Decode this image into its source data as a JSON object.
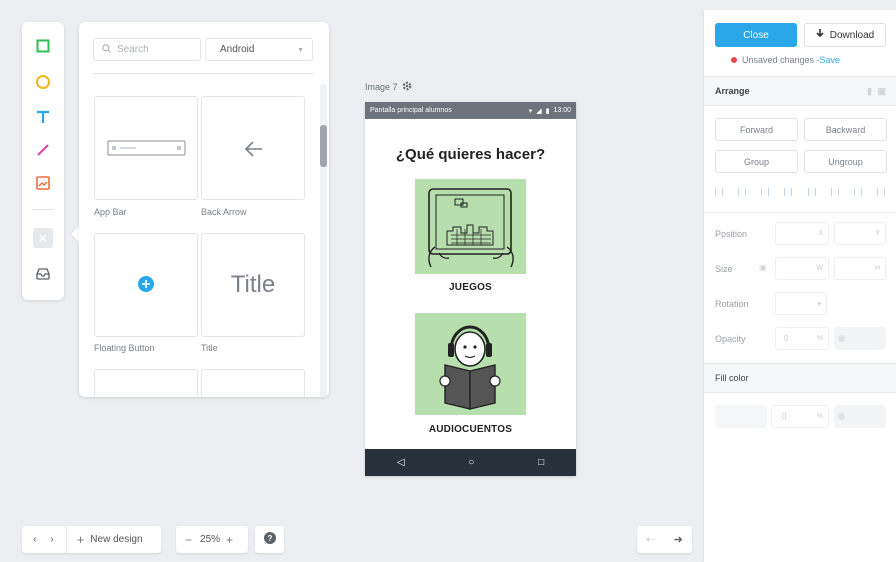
{
  "toolbar_tools": [
    {
      "name": "rectangle-tool",
      "color": "#2ebd59"
    },
    {
      "name": "circle-tool",
      "color": "#f3b51b"
    },
    {
      "name": "text-tool",
      "color": "#29a7e8"
    },
    {
      "name": "line-tool",
      "color": "#e040a0"
    },
    {
      "name": "image-tool",
      "color": "#f06a3a"
    }
  ],
  "panel": {
    "search_placeholder": "Search",
    "platform": "Android",
    "cards": [
      {
        "label": "App Bar"
      },
      {
        "label": "Back Arrow"
      },
      {
        "label": "Floating Button"
      },
      {
        "label": "Title",
        "preview_text": "Title"
      }
    ]
  },
  "artboard": {
    "label": "Image 7",
    "status_left": "Pantalla principal alumnos",
    "status_time": "13:00",
    "heading": "¿Qué quieres hacer?",
    "tiles": [
      {
        "caption": "JUEGOS",
        "color": "#b7dfae"
      },
      {
        "caption": "AUDIOCUENTOS",
        "color": "#b7dfae"
      }
    ]
  },
  "bottom": {
    "new_design": "New design",
    "zoom": "25%"
  },
  "inspector": {
    "close_label": "Close",
    "download_label": "Download",
    "unsaved_text": "Unsaved changes - ",
    "save_link": "Save",
    "arrange_title": "Arrange",
    "forward": "Forward",
    "backward": "Backward",
    "group": "Group",
    "ungroup": "Ungroup",
    "position_label": "Position",
    "size_label": "Size",
    "rotation_label": "Rotation",
    "opacity_label": "Opacity",
    "fill_title": "Fill color",
    "x_hint": "X",
    "y_hint": "Y",
    "w_hint": "W",
    "h_hint": "H",
    "opacity_value": "0",
    "percent": "%",
    "fill_value": "0"
  },
  "colors": {
    "accent": "#29a7e8",
    "unsaved_dot": "#e8474b",
    "tile_green": "#b7dfae",
    "nav_dark": "#27313b"
  }
}
